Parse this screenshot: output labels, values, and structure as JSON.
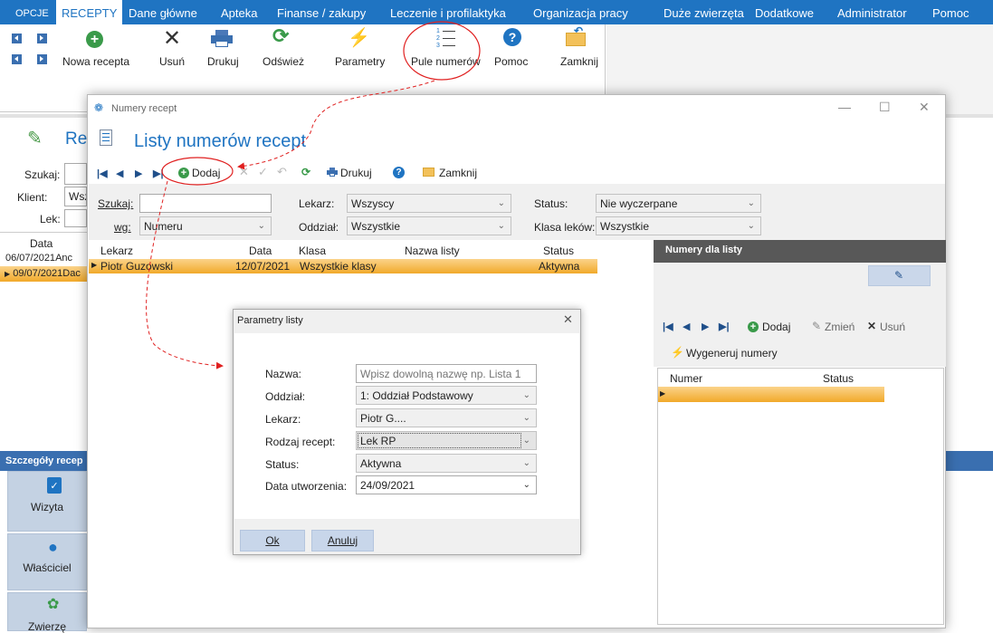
{
  "menubar": {
    "tabs": [
      "OPCJE",
      "RECEPTY",
      "Dane główne",
      "Apteka",
      "Finanse / zakupy",
      "Leczenie i profilaktyka",
      "Organizacja pracy",
      "Duże zwierzęta",
      "Dodatkowe",
      "Administrator",
      "Pomoc"
    ],
    "active": "RECEPTY"
  },
  "ribbon": {
    "nowa_recepta": "Nowa recepta",
    "usun": "Usuń",
    "drukuj": "Drukuj",
    "odswiez": "Odśwież",
    "parametry": "Parametry",
    "pule_numerow": "Pule numerów",
    "pomoc": "Pomoc",
    "zamknij": "Zamknij"
  },
  "background": {
    "page_title_fragment": "Re",
    "szukaj_label": "Szukaj:",
    "klient_label": "Klient:",
    "klient_value": "Wsz",
    "lek_label": "Lek:",
    "col_data": "Data",
    "rows": [
      {
        "date": "06/07/2021",
        "name": "Anc"
      },
      {
        "date": "09/07/2021",
        "name": "Dac"
      }
    ],
    "szczegoly": "Szczegóły recep",
    "side_buttons": [
      "Wizyta",
      "Właściciel",
      "Zwierzę"
    ]
  },
  "dialog": {
    "window_title": "Numery recept",
    "heading": "Listy numerów recept",
    "toolbar": {
      "dodaj": "Dodaj",
      "drukuj": "Drukuj",
      "zamknij": "Zamknij"
    },
    "filters": {
      "szukaj_label": "Szukaj:",
      "wg_label": "wg:",
      "wg_value": "Numeru",
      "lekarz_label": "Lekarz:",
      "lekarz_value": "Wszyscy",
      "oddzial_label": "Oddział:",
      "oddzial_value": "Wszystkie",
      "status_label": "Status:",
      "status_value": "Nie wyczerpane",
      "klasa_label": "Klasa leków:",
      "klasa_value": "Wszystkie"
    },
    "grid": {
      "columns": [
        "Lekarz",
        "Data",
        "Klasa",
        "Nazwa listy",
        "Status"
      ],
      "rows": [
        {
          "lekarz": "Piotr Guzowski",
          "data": "12/07/2021",
          "klasa": "Wszystkie klasy",
          "nazwa": "",
          "status": "Aktywna"
        }
      ]
    },
    "right_panel": {
      "header": "Numery dla listy",
      "dodaj": "Dodaj",
      "zmien": "Zmień",
      "usun": "Usuń",
      "wygeneruj": "Wygeneruj numery",
      "columns": [
        "Numer",
        "Status"
      ]
    }
  },
  "params": {
    "title": "Parametry listy",
    "fields": {
      "nazwa_label": "Nazwa:",
      "nazwa_placeholder": "Wpisz dowolną nazwę np. Lista 1",
      "oddzial_label": "Oddział:",
      "oddzial_value": "1: Oddział Podstawowy",
      "lekarz_label": "Lekarz:",
      "lekarz_value": "Piotr G....",
      "rodzaj_label": "Rodzaj recept:",
      "rodzaj_value": "Lek RP",
      "status_label": "Status:",
      "status_value": "Aktywna",
      "data_label": "Data utworzenia:",
      "data_value": "24/09/2021"
    },
    "ok": "Ok",
    "anuluj": "Anuluj"
  },
  "colors": {
    "brand_blue": "#1f74c2",
    "selection_orange": "#f1a92a",
    "annotation_red": "#e02020"
  }
}
